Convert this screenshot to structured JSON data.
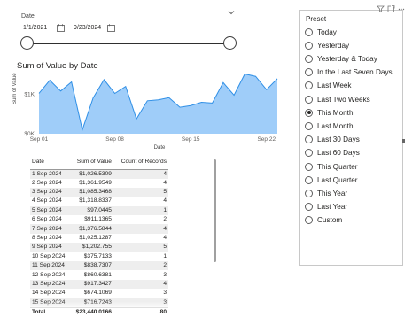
{
  "date_slicer": {
    "title": "Date",
    "start_date": "1/1/2021",
    "end_date": "9/23/2024",
    "range_start_fraction": 0,
    "range_end_fraction": 1
  },
  "chart": {
    "title": "Sum of Value by Date",
    "ylabel": "Sum of Value",
    "xlabel": "Date",
    "y_ticks": [
      "$0K",
      "$1K"
    ],
    "x_ticks": [
      "Sep 01",
      "Sep 08",
      "Sep 15",
      "Sep 22"
    ]
  },
  "chart_data": {
    "type": "area",
    "title": "Sum of Value by Date",
    "xlabel": "Date",
    "ylabel": "Sum of Value",
    "x": [
      "Sep 1",
      "Sep 2",
      "Sep 3",
      "Sep 4",
      "Sep 5",
      "Sep 6",
      "Sep 7",
      "Sep 8",
      "Sep 9",
      "Sep 10",
      "Sep 11",
      "Sep 12",
      "Sep 13",
      "Sep 14",
      "Sep 15",
      "Sep 16",
      "Sep 17",
      "Sep 18",
      "Sep 19",
      "Sep 20",
      "Sep 21",
      "Sep 22",
      "Sep 23"
    ],
    "series": [
      {
        "values": [
          1026.5309,
          1361.9549,
          1085.3468,
          1318.8337,
          97.0445,
          911.1365,
          1376.5844,
          1025.1287,
          1202.755,
          375.7133,
          838.7307,
          860.6381,
          917.3427,
          674.1069,
          716.7243,
          800,
          780,
          1300,
          980,
          1520,
          1460,
          1120,
          1400
        ],
        "color": "#9fcdf9"
      }
    ],
    "y_ticks": [
      "$0K",
      "$1K"
    ],
    "x_ticks": [
      "Sep 01",
      "Sep 08",
      "Sep 15",
      "Sep 22"
    ],
    "ylim": [
      0,
      1600
    ],
    "grid": false,
    "legend": "none"
  },
  "table": {
    "headers": [
      "Date",
      "Sum of Value",
      "Count of Records"
    ],
    "rows": [
      [
        "1 Sep 2024",
        "$1,026.5309",
        "4"
      ],
      [
        "2 Sep 2024",
        "$1,361.9549",
        "4"
      ],
      [
        "3 Sep 2024",
        "$1,085.3468",
        "5"
      ],
      [
        "4 Sep 2024",
        "$1,318.8337",
        "4"
      ],
      [
        "5 Sep 2024",
        "$97.0445",
        "1"
      ],
      [
        "6 Sep 2024",
        "$911.1365",
        "2"
      ],
      [
        "7 Sep 2024",
        "$1,376.5844",
        "4"
      ],
      [
        "8 Sep 2024",
        "$1,025.1287",
        "4"
      ],
      [
        "9 Sep 2024",
        "$1,202.755",
        "5"
      ],
      [
        "10 Sep 2024",
        "$375.7133",
        "1"
      ],
      [
        "11 Sep 2024",
        "$838.7307",
        "2"
      ],
      [
        "12 Sep 2024",
        "$860.6381",
        "3"
      ],
      [
        "13 Sep 2024",
        "$917.3427",
        "4"
      ],
      [
        "14 Sep 2024",
        "$674.1069",
        "3"
      ],
      [
        "15 Sep 2024",
        "$716.7243",
        "3"
      ]
    ],
    "total": [
      "Total",
      "$23,440.0166",
      "80"
    ]
  },
  "preset": {
    "title": "Preset",
    "selected": "This Month",
    "options": [
      "Today",
      "Yesterday",
      "Yesterday & Today",
      "In the Last Seven Days",
      "Last Week",
      "Last Two Weeks",
      "This Month",
      "Last Month",
      "Last 30 Days",
      "Last 60 Days",
      "This Quarter",
      "Last Quarter",
      "This Year",
      "Last Year",
      "Custom"
    ]
  },
  "icons": {
    "chevron": "chevron-down-icon",
    "calendar": "calendar-icon",
    "filter": "filter-icon",
    "focus": "focus-mode-icon",
    "more": "more-options-icon"
  },
  "colors": {
    "area_fill": "#9fcdf9",
    "area_line": "#2f8fe6",
    "slider_track": "#2f2f2f"
  }
}
